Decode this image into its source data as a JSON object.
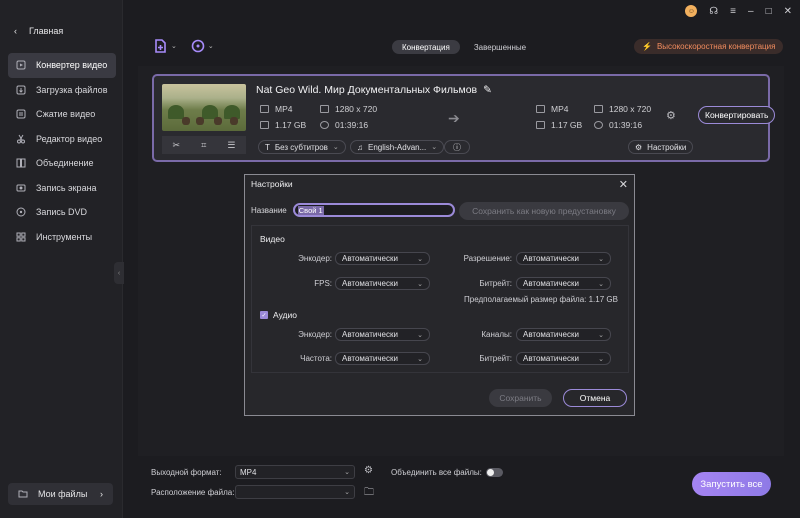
{
  "sidebar": {
    "home_label": "Главная",
    "items": [
      {
        "label": "Конвертер видео",
        "icon": "video-convert-icon"
      },
      {
        "label": "Загрузка файлов",
        "icon": "download-icon"
      },
      {
        "label": "Сжатие видео",
        "icon": "compress-icon"
      },
      {
        "label": "Редактор видео",
        "icon": "scissors-icon"
      },
      {
        "label": "Объединение",
        "icon": "merge-icon"
      },
      {
        "label": "Запись экрана",
        "icon": "record-icon"
      },
      {
        "label": "Запись DVD",
        "icon": "disc-icon"
      },
      {
        "label": "Инструменты",
        "icon": "grid-icon"
      }
    ],
    "my_files_label": "Мои файлы"
  },
  "tabs": {
    "convert": "Конвертация",
    "done": "Завершенные"
  },
  "badge": {
    "hs": "Высокоскоростная конвертация",
    "color": "#f28c5e"
  },
  "file": {
    "title": "Nat Geo Wild. Мир Документальных Фильмов",
    "src_format": "MP4",
    "src_size": "1.17 GB",
    "src_res": "1280 x 720",
    "src_dur": "01:39:16",
    "dst_format": "MP4",
    "dst_size": "1.17 GB",
    "dst_res": "1280 x 720",
    "dst_dur": "01:39:16",
    "convert_label": "Конвертировать",
    "subtitles": "Без субтитров",
    "audio": "English-Advan...",
    "settings_label": "Настройки"
  },
  "dialog": {
    "title": "Настройки",
    "name_label": "Название",
    "name_value": "Свой 1",
    "save_as_label": "Сохранить как новую предустановку",
    "video_section": "Видео",
    "audio_section": "Аудио",
    "encoder_label": "Энкодер:",
    "fps_label": "FPS:",
    "resolution_label": "Разрешение:",
    "bitrate_label": "Битрейт:",
    "channels_label": "Каналы:",
    "samplerate_label": "Частота:",
    "auto": "Автоматически",
    "est_size": "Предполагаемый размер файла: 1.17 GB",
    "save_label": "Сохранить",
    "cancel_label": "Отмена"
  },
  "bottom": {
    "format_label": "Выходной формат:",
    "format_value": "MP4",
    "merge_label": "Объединить все файлы:",
    "location_label": "Расположение файла:",
    "location_value": "",
    "start_label": "Запустить все"
  },
  "accent": "#9b8ad8"
}
